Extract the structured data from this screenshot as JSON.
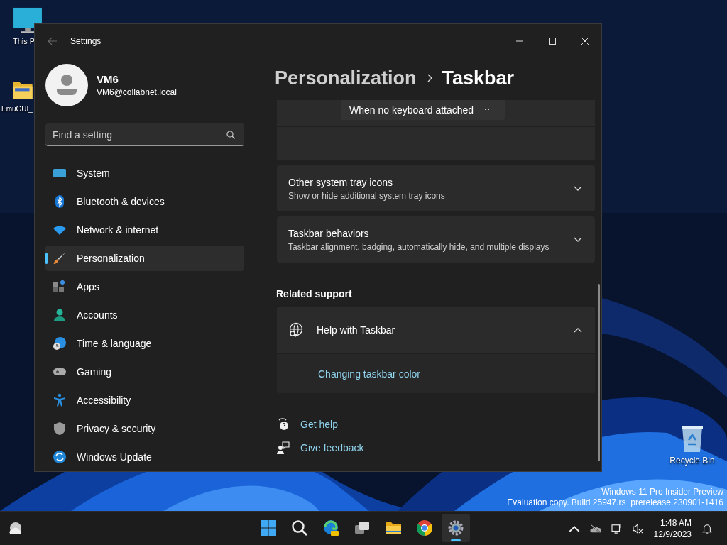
{
  "desktop": {
    "icons": [
      {
        "label": "This P",
        "kind": "monitor"
      },
      {
        "label": "EmuGUI_",
        "kind": "folder"
      },
      {
        "label": "Recycle Bin",
        "kind": "bin"
      }
    ],
    "build_info": [
      "Windows 11 Pro Insider Preview",
      "Evaluation copy. Build 25947.rs_prerelease.230901-1416"
    ]
  },
  "window": {
    "title": "Settings"
  },
  "profile": {
    "name": "VM6",
    "email": "VM6@collabnet.local"
  },
  "search": {
    "placeholder": "Find a setting"
  },
  "nav": [
    {
      "label": "System",
      "kind": "system",
      "selected": false
    },
    {
      "label": "Bluetooth & devices",
      "kind": "bluetooth",
      "selected": false
    },
    {
      "label": "Network & internet",
      "kind": "network",
      "selected": false
    },
    {
      "label": "Personalization",
      "kind": "brush",
      "selected": true
    },
    {
      "label": "Apps",
      "kind": "apps",
      "selected": false
    },
    {
      "label": "Accounts",
      "kind": "accounts",
      "selected": false
    },
    {
      "label": "Time & language",
      "kind": "time",
      "selected": false
    },
    {
      "label": "Gaming",
      "kind": "gaming",
      "selected": false
    },
    {
      "label": "Accessibility",
      "kind": "accessibility",
      "selected": false
    },
    {
      "label": "Privacy & security",
      "kind": "privacy",
      "selected": false
    },
    {
      "label": "Windows Update",
      "kind": "update",
      "selected": false
    }
  ],
  "breadcrumb": {
    "parent": "Personalization",
    "current": "Taskbar"
  },
  "cards": [
    {
      "kind": "dropdown",
      "value": "When no keyboard attached"
    },
    {
      "kind": "expander",
      "title": "Other system tray icons",
      "subtitle": "Show or hide additional system tray icons",
      "expanded": false
    },
    {
      "kind": "expander",
      "title": "Taskbar behaviors",
      "subtitle": "Taskbar alignment, badging, automatically hide, and multiple displays",
      "expanded": false
    }
  ],
  "related": {
    "heading": "Related support",
    "title": "Help with Taskbar",
    "expanded": true,
    "links": [
      "Changing taskbar color"
    ]
  },
  "footer_links": [
    {
      "label": "Get help",
      "kind": "help"
    },
    {
      "label": "Give feedback",
      "kind": "feedback"
    }
  ],
  "taskbar": {
    "apps": [
      {
        "kind": "start",
        "selected": false
      },
      {
        "kind": "search",
        "selected": false
      },
      {
        "kind": "edge",
        "selected": false
      },
      {
        "kind": "taskview",
        "selected": false
      },
      {
        "kind": "explorer",
        "selected": false
      },
      {
        "kind": "chrome",
        "selected": false
      },
      {
        "kind": "settings",
        "selected": true
      }
    ],
    "time": "1:48 AM",
    "date": "12/9/2023"
  }
}
